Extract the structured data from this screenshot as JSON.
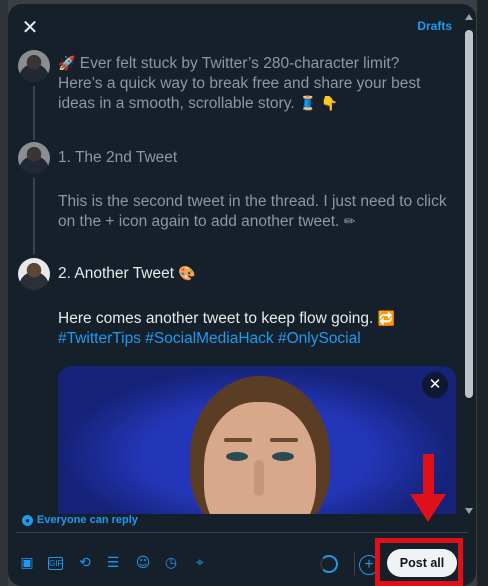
{
  "header": {
    "close_glyph": "✕",
    "drafts_label": "Drafts"
  },
  "thread": [
    {
      "text": "Ever felt stuck by Twitter’s 280-character limit? Here’s a quick way to break free and share your best ideas in a smooth, scrollable story.",
      "lead_emoji": "🚀",
      "trail_emojis": "🧵 👇"
    },
    {
      "title": "1. The 2nd Tweet",
      "body": "This is the second tweet in the thread. I just need to click on the + icon again to add another tweet.",
      "body_emoji": "✏"
    },
    {
      "title": "2. Another Tweet",
      "title_emoji": "🎨",
      "body": "Here comes another tweet to keep flow going.",
      "body_emoji": "🔁",
      "hashtags": [
        "#TwitterTips",
        "#SocialMediaHack",
        "#OnlySocial"
      ]
    }
  ],
  "media": {
    "close_glyph": "✕"
  },
  "reply_setting": {
    "label": "Everyone can reply"
  },
  "toolbar": {
    "icons": [
      "image-icon",
      "gif-icon",
      "grok-icon",
      "poll-icon",
      "emoji-icon",
      "schedule-icon",
      "location-icon"
    ],
    "add_glyph": "+",
    "post_all_label": "Post all"
  },
  "colors": {
    "accent": "#1d9bf0",
    "background": "#15202b",
    "highlight": "#e0101b"
  }
}
